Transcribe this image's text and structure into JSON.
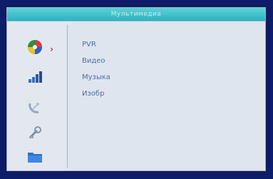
{
  "window": {
    "title": "Мультимедиа"
  },
  "sidebar": {
    "items": [
      {
        "icon": "multimedia-ball-icon",
        "selected": true
      },
      {
        "icon": "signal-bars-icon",
        "selected": false
      },
      {
        "icon": "satellite-dish-icon",
        "selected": false
      },
      {
        "icon": "tools-icon",
        "selected": false
      },
      {
        "icon": "folder-icon",
        "selected": false
      }
    ]
  },
  "menu": {
    "items": [
      {
        "label": "PVR"
      },
      {
        "label": "Видео"
      },
      {
        "label": "Музыка"
      },
      {
        "label": "Изобр"
      }
    ]
  },
  "colors": {
    "title_bar": "#2cb1c0",
    "menu_text": "#4d6fa3",
    "background": "#dfe5ee",
    "bezel": "#0e1d6a"
  }
}
